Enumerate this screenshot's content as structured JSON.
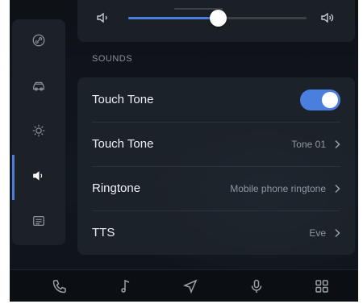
{
  "sidebar": {
    "items": [
      {
        "icon": "link-icon",
        "active": false
      },
      {
        "icon": "car-icon",
        "active": false
      },
      {
        "icon": "brightness-icon",
        "active": false
      },
      {
        "icon": "speaker-icon",
        "active": true
      },
      {
        "icon": "message-icon",
        "active": false
      }
    ]
  },
  "volume": {
    "level": 0.5,
    "low_icon": "speaker-low-icon",
    "high_icon": "speaker-high-icon"
  },
  "sounds": {
    "section_title": "SOUNDS",
    "rows": [
      {
        "label": "Touch Tone",
        "type": "toggle",
        "on": true
      },
      {
        "label": "Touch Tone",
        "type": "link",
        "value": "Tone 01"
      },
      {
        "label": "Ringtone",
        "type": "link",
        "value": "Mobile phone ringtone"
      },
      {
        "label": "TTS",
        "type": "link",
        "value": "Eve"
      }
    ]
  },
  "bottom_nav": {
    "items": [
      "phone-icon",
      "music-icon",
      "navigation-icon",
      "microphone-icon",
      "apps-grid-icon"
    ]
  },
  "colors": {
    "accent": "#4a7fe0",
    "background": "#0e1116",
    "panel": "#1c2128"
  }
}
